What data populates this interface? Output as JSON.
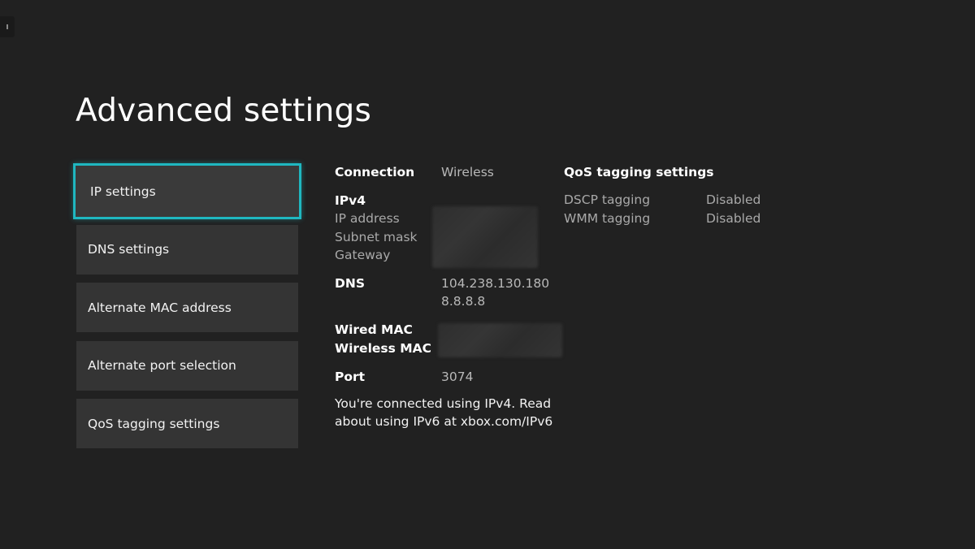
{
  "header": {
    "title": "Advanced settings"
  },
  "menu": {
    "items": [
      {
        "label": "IP settings"
      },
      {
        "label": "DNS settings"
      },
      {
        "label": "Alternate MAC address"
      },
      {
        "label": "Alternate port selection"
      },
      {
        "label": "QoS tagging settings"
      }
    ],
    "selected_index": 0
  },
  "details": {
    "connection_label": "Connection",
    "connection_value": "Wireless",
    "ipv4_label": "IPv4",
    "ip_address_label": "IP address",
    "subnet_mask_label": "Subnet mask",
    "gateway_label": "Gateway",
    "dns_label": "DNS",
    "dns_primary": "104.238.130.180",
    "dns_secondary": "8.8.8.8",
    "wired_mac_label": "Wired MAC",
    "wireless_mac_label": "Wireless MAC",
    "port_label": "Port",
    "port_value": "3074",
    "note_line1": "You're connected using IPv4. Read",
    "note_line2": "about using IPv6 at xbox.com/IPv6"
  },
  "qos": {
    "title": "QoS tagging settings",
    "rows": [
      {
        "label": "DSCP tagging",
        "value": "Disabled"
      },
      {
        "label": "WMM tagging",
        "value": "Disabled"
      }
    ]
  },
  "colors": {
    "background": "#212121",
    "tile": "#343434",
    "focus_accent": "#1fb7c0",
    "secondary_text": "#a9a9a9"
  }
}
